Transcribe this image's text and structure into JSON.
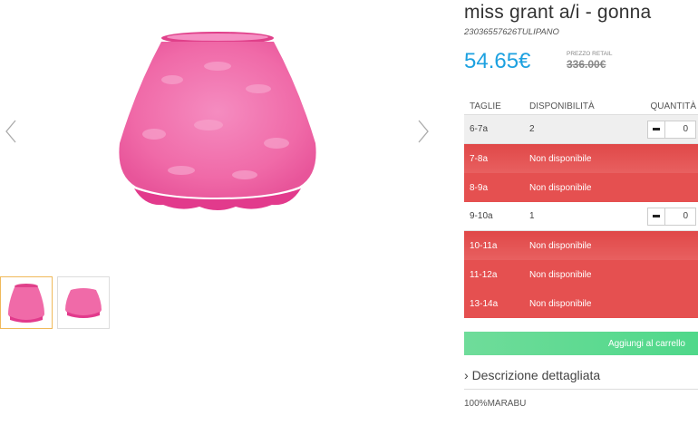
{
  "product": {
    "title": "miss grant a/i - gonna",
    "sku": "23036557626TULIPANO",
    "price": "54.65€",
    "retail_label": "PREZZO RETAIL",
    "retail_price": "336.00€",
    "colors": {
      "price": "#1da1e0",
      "unavailable": "#e55050",
      "cart": "#5dd990",
      "skirt": "#f06aa8"
    }
  },
  "table": {
    "headers": [
      "TAGLIE",
      "DISPONIBILITÀ",
      "QUANTITÀ"
    ],
    "rows": [
      {
        "size": "6-7a",
        "availability": "2",
        "quantity": "0"
      },
      {
        "size": "7-8a",
        "availability": "Non disponibile"
      },
      {
        "size": "8-9a",
        "availability": "Non disponibile"
      },
      {
        "size": "9-10a",
        "availability": "1",
        "quantity": "0"
      },
      {
        "size": "10-11a",
        "availability": "Non disponibile"
      },
      {
        "size": "11-12a",
        "availability": "Non disponibile"
      },
      {
        "size": "13-14a",
        "availability": "Non disponibile"
      }
    ]
  },
  "actions": {
    "add_to_cart": "Aggiungi al carrello"
  },
  "description": {
    "toggle": "Descrizione dettagliata",
    "text": "100%MARABU"
  },
  "gallery": {
    "icons": [
      "chevron-left-icon",
      "chevron-right-icon"
    ]
  }
}
